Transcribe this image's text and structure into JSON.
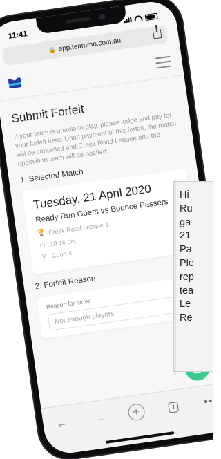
{
  "status": {
    "time": "11:41"
  },
  "browser": {
    "url": "app.teammo.com.au"
  },
  "page": {
    "title": "Submit Forfeit",
    "intro": "If your team is unable to play, please lodge and pay for your forfeit here. Upon payment of this forfeit, the match will be cancelled and Creek Road League and the opposition team will be notified."
  },
  "selected_match": {
    "heading": "1. Selected Match",
    "date": "Tuesday, 21 April 2020",
    "teams": "Ready Run Goers vs Bounce Passers",
    "league": "Creek Road League 1",
    "time": "10:16 pm",
    "court": "Court 4"
  },
  "forfeit_reason": {
    "heading": "2. Forfeit Reason",
    "field_label": "Reason for forfeit",
    "placeholder": "Not enough players"
  },
  "toolbar": {
    "tabs_count": "1"
  },
  "tooltip": {
    "lines": [
      "Hi",
      "Ru",
      "ga",
      "21",
      "Pa",
      "Ple",
      "rep",
      "tea",
      "Le",
      "Re"
    ]
  },
  "colors": {
    "accent": "#3cc98f",
    "brand": "#2a3a9f",
    "brand_stripe": "#2ec4e6"
  }
}
